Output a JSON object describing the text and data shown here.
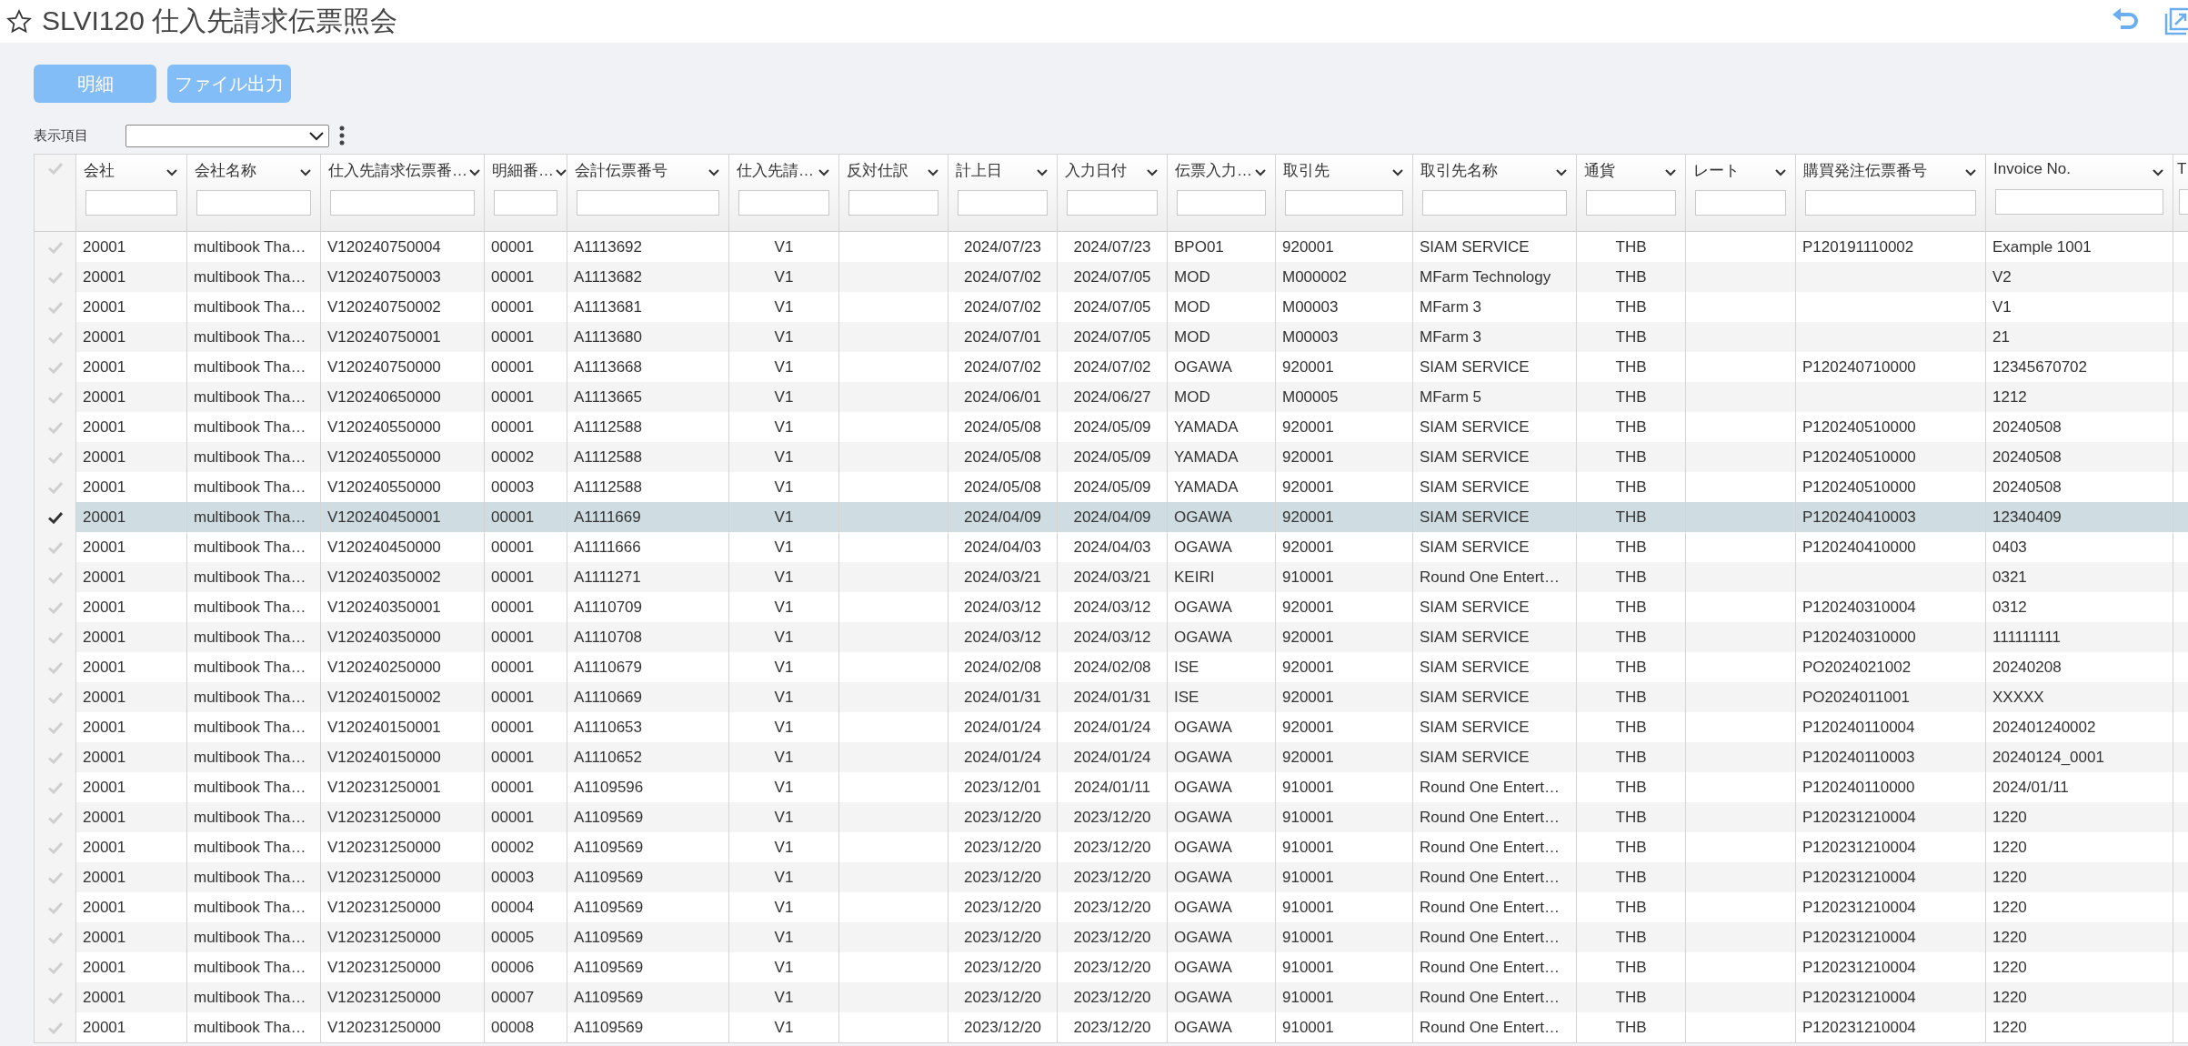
{
  "title": "SLVI120 仕入先請求伝票照会",
  "buttons": [
    {
      "label": "明細"
    },
    {
      "label": "ファイル出力"
    }
  ],
  "display_items": {
    "label": "表示項目"
  },
  "columns": [
    {
      "label": "会社"
    },
    {
      "label": "会社名称"
    },
    {
      "label": "仕入先請求伝票番…"
    },
    {
      "label": "明細番…"
    },
    {
      "label": "会計伝票番号"
    },
    {
      "label": "仕入先請…"
    },
    {
      "label": "反対仕訳"
    },
    {
      "label": "計上日"
    },
    {
      "label": "入力日付"
    },
    {
      "label": "伝票入力…"
    },
    {
      "label": "取引先"
    },
    {
      "label": "取引先名称"
    },
    {
      "label": "通貨"
    },
    {
      "label": "レート"
    },
    {
      "label": "購買発注伝票番号"
    },
    {
      "label": "Invoice No."
    },
    {
      "label": "T"
    }
  ],
  "rows": [
    {
      "selected": false,
      "cells": [
        "20001",
        "multibook Tha…",
        "V120240750004",
        "00001",
        "A1113692",
        "V1",
        null,
        "2024/07/23",
        "2024/07/23",
        "BPO01",
        "920001",
        "SIAM SERVICE",
        "THB",
        null,
        "P120191110002",
        "Example 1001"
      ]
    },
    {
      "selected": false,
      "cells": [
        "20001",
        "multibook Tha…",
        "V120240750003",
        "00001",
        "A1113682",
        "V1",
        null,
        "2024/07/02",
        "2024/07/05",
        "MOD",
        "M000002",
        "MFarm Technology",
        "THB",
        null,
        null,
        "V2"
      ]
    },
    {
      "selected": false,
      "cells": [
        "20001",
        "multibook Tha…",
        "V120240750002",
        "00001",
        "A1113681",
        "V1",
        null,
        "2024/07/02",
        "2024/07/05",
        "MOD",
        "M00003",
        "MFarm 3",
        "THB",
        null,
        null,
        "V1"
      ]
    },
    {
      "selected": false,
      "cells": [
        "20001",
        "multibook Tha…",
        "V120240750001",
        "00001",
        "A1113680",
        "V1",
        null,
        "2024/07/01",
        "2024/07/05",
        "MOD",
        "M00003",
        "MFarm 3",
        "THB",
        null,
        null,
        "21"
      ]
    },
    {
      "selected": false,
      "cells": [
        "20001",
        "multibook Tha…",
        "V120240750000",
        "00001",
        "A1113668",
        "V1",
        null,
        "2024/07/02",
        "2024/07/02",
        "OGAWA",
        "920001",
        "SIAM SERVICE",
        "THB",
        null,
        "P120240710000",
        "12345670702"
      ]
    },
    {
      "selected": false,
      "cells": [
        "20001",
        "multibook Tha…",
        "V120240650000",
        "00001",
        "A1113665",
        "V1",
        null,
        "2024/06/01",
        "2024/06/27",
        "MOD",
        "M00005",
        "MFarm 5",
        "THB",
        null,
        null,
        "1212"
      ]
    },
    {
      "selected": false,
      "cells": [
        "20001",
        "multibook Tha…",
        "V120240550000",
        "00001",
        "A1112588",
        "V1",
        null,
        "2024/05/08",
        "2024/05/09",
        "YAMADA",
        "920001",
        "SIAM SERVICE",
        "THB",
        null,
        "P120240510000",
        "20240508"
      ]
    },
    {
      "selected": false,
      "cells": [
        "20001",
        "multibook Tha…",
        "V120240550000",
        "00002",
        "A1112588",
        "V1",
        null,
        "2024/05/08",
        "2024/05/09",
        "YAMADA",
        "920001",
        "SIAM SERVICE",
        "THB",
        null,
        "P120240510000",
        "20240508"
      ]
    },
    {
      "selected": false,
      "cells": [
        "20001",
        "multibook Tha…",
        "V120240550000",
        "00003",
        "A1112588",
        "V1",
        null,
        "2024/05/08",
        "2024/05/09",
        "YAMADA",
        "920001",
        "SIAM SERVICE",
        "THB",
        null,
        "P120240510000",
        "20240508"
      ]
    },
    {
      "selected": true,
      "cells": [
        "20001",
        "multibook Tha…",
        "V120240450001",
        "00001",
        "A1111669",
        "V1",
        null,
        "2024/04/09",
        "2024/04/09",
        "OGAWA",
        "920001",
        "SIAM SERVICE",
        "THB",
        null,
        "P120240410003",
        "12340409"
      ]
    },
    {
      "selected": false,
      "cells": [
        "20001",
        "multibook Tha…",
        "V120240450000",
        "00001",
        "A1111666",
        "V1",
        null,
        "2024/04/03",
        "2024/04/03",
        "OGAWA",
        "920001",
        "SIAM SERVICE",
        "THB",
        null,
        "P120240410000",
        "0403"
      ]
    },
    {
      "selected": false,
      "cells": [
        "20001",
        "multibook Tha…",
        "V120240350002",
        "00001",
        "A1111271",
        "V1",
        null,
        "2024/03/21",
        "2024/03/21",
        "KEIRI",
        "910001",
        "Round One Entert…",
        "THB",
        null,
        null,
        "0321"
      ]
    },
    {
      "selected": false,
      "cells": [
        "20001",
        "multibook Tha…",
        "V120240350001",
        "00001",
        "A1110709",
        "V1",
        null,
        "2024/03/12",
        "2024/03/12",
        "OGAWA",
        "920001",
        "SIAM SERVICE",
        "THB",
        null,
        "P120240310004",
        "0312"
      ]
    },
    {
      "selected": false,
      "cells": [
        "20001",
        "multibook Tha…",
        "V120240350000",
        "00001",
        "A1110708",
        "V1",
        null,
        "2024/03/12",
        "2024/03/12",
        "OGAWA",
        "920001",
        "SIAM SERVICE",
        "THB",
        null,
        "P120240310000",
        "111111111"
      ]
    },
    {
      "selected": false,
      "cells": [
        "20001",
        "multibook Tha…",
        "V120240250000",
        "00001",
        "A1110679",
        "V1",
        null,
        "2024/02/08",
        "2024/02/08",
        "ISE",
        "920001",
        "SIAM SERVICE",
        "THB",
        null,
        "PO2024021002",
        "20240208"
      ]
    },
    {
      "selected": false,
      "cells": [
        "20001",
        "multibook Tha…",
        "V120240150002",
        "00001",
        "A1110669",
        "V1",
        null,
        "2024/01/31",
        "2024/01/31",
        "ISE",
        "920001",
        "SIAM SERVICE",
        "THB",
        null,
        "PO2024011001",
        "XXXXX"
      ]
    },
    {
      "selected": false,
      "cells": [
        "20001",
        "multibook Tha…",
        "V120240150001",
        "00001",
        "A1110653",
        "V1",
        null,
        "2024/01/24",
        "2024/01/24",
        "OGAWA",
        "920001",
        "SIAM SERVICE",
        "THB",
        null,
        "P120240110004",
        "202401240002"
      ]
    },
    {
      "selected": false,
      "cells": [
        "20001",
        "multibook Tha…",
        "V120240150000",
        "00001",
        "A1110652",
        "V1",
        null,
        "2024/01/24",
        "2024/01/24",
        "OGAWA",
        "920001",
        "SIAM SERVICE",
        "THB",
        null,
        "P120240110003",
        "20240124_0001"
      ]
    },
    {
      "selected": false,
      "cells": [
        "20001",
        "multibook Tha…",
        "V120231250001",
        "00001",
        "A1109596",
        "V1",
        null,
        "2023/12/01",
        "2024/01/11",
        "OGAWA",
        "910001",
        "Round One Entert…",
        "THB",
        null,
        "P120240110000",
        "2024/01/11"
      ]
    },
    {
      "selected": false,
      "cells": [
        "20001",
        "multibook Tha…",
        "V120231250000",
        "00001",
        "A1109569",
        "V1",
        null,
        "2023/12/20",
        "2023/12/20",
        "OGAWA",
        "910001",
        "Round One Entert…",
        "THB",
        null,
        "P120231210004",
        "1220"
      ]
    },
    {
      "selected": false,
      "cells": [
        "20001",
        "multibook Tha…",
        "V120231250000",
        "00002",
        "A1109569",
        "V1",
        null,
        "2023/12/20",
        "2023/12/20",
        "OGAWA",
        "910001",
        "Round One Entert…",
        "THB",
        null,
        "P120231210004",
        "1220"
      ]
    },
    {
      "selected": false,
      "cells": [
        "20001",
        "multibook Tha…",
        "V120231250000",
        "00003",
        "A1109569",
        "V1",
        null,
        "2023/12/20",
        "2023/12/20",
        "OGAWA",
        "910001",
        "Round One Entert…",
        "THB",
        null,
        "P120231210004",
        "1220"
      ]
    },
    {
      "selected": false,
      "cells": [
        "20001",
        "multibook Tha…",
        "V120231250000",
        "00004",
        "A1109569",
        "V1",
        null,
        "2023/12/20",
        "2023/12/20",
        "OGAWA",
        "910001",
        "Round One Entert…",
        "THB",
        null,
        "P120231210004",
        "1220"
      ]
    },
    {
      "selected": false,
      "cells": [
        "20001",
        "multibook Tha…",
        "V120231250000",
        "00005",
        "A1109569",
        "V1",
        null,
        "2023/12/20",
        "2023/12/20",
        "OGAWA",
        "910001",
        "Round One Entert…",
        "THB",
        null,
        "P120231210004",
        "1220"
      ]
    },
    {
      "selected": false,
      "cells": [
        "20001",
        "multibook Tha…",
        "V120231250000",
        "00006",
        "A1109569",
        "V1",
        null,
        "2023/12/20",
        "2023/12/20",
        "OGAWA",
        "910001",
        "Round One Entert…",
        "THB",
        null,
        "P120231210004",
        "1220"
      ]
    },
    {
      "selected": false,
      "cells": [
        "20001",
        "multibook Tha…",
        "V120231250000",
        "00007",
        "A1109569",
        "V1",
        null,
        "2023/12/20",
        "2023/12/20",
        "OGAWA",
        "910001",
        "Round One Entert…",
        "THB",
        null,
        "P120231210004",
        "1220"
      ]
    },
    {
      "selected": false,
      "cells": [
        "20001",
        "multibook Tha…",
        "V120231250000",
        "00008",
        "A1109569",
        "V1",
        null,
        "2023/12/20",
        "2023/12/20",
        "OGAWA",
        "910001",
        "Round One Entert…",
        "THB",
        null,
        "P120231210004",
        "1220"
      ]
    }
  ]
}
